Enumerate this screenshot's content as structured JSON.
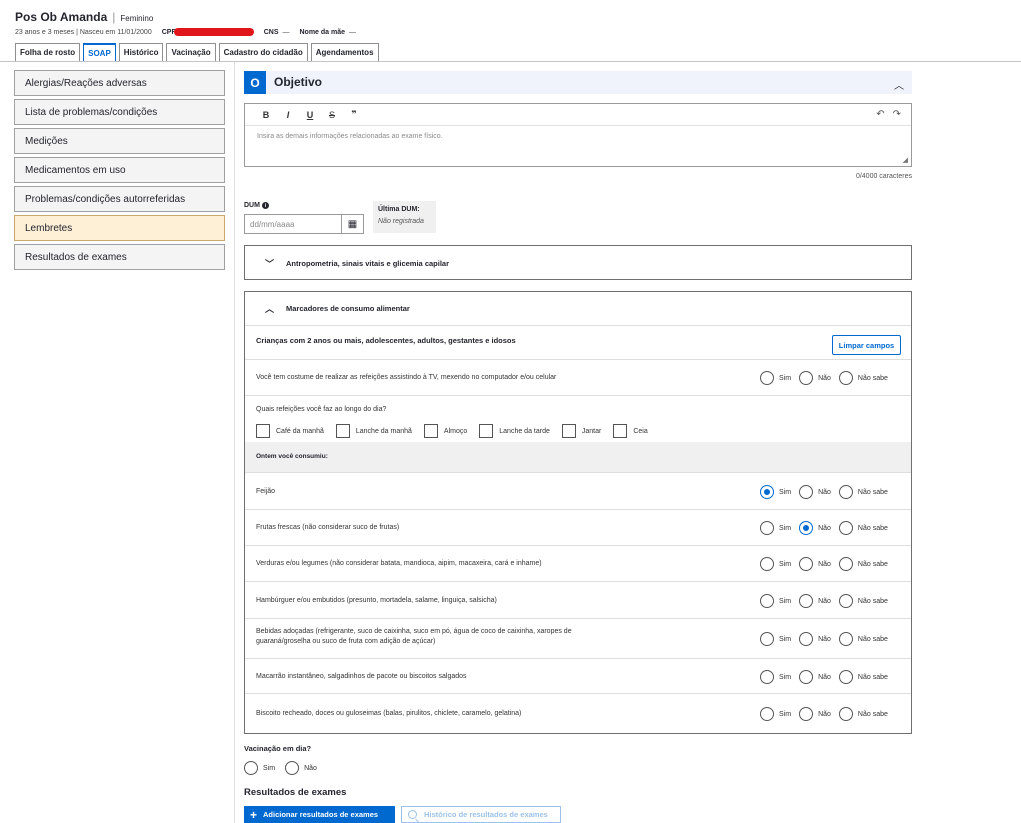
{
  "patient": {
    "name": "Pos Ob Amanda",
    "gender": "Feminino",
    "age_birth": "23 anos e 3 meses | Nasceu em 11/01/2000",
    "cpf_label": "CPF",
    "cns_label": "CNS",
    "cns_value": "—",
    "mother_label": "Nome da mãe",
    "mother_value": "—"
  },
  "tabs": [
    "Folha de rosto",
    "SOAP",
    "Histórico",
    "Vacinação",
    "Cadastro do cidadão",
    "Agendamentos"
  ],
  "active_tab": "SOAP",
  "sidebar": {
    "items": [
      "Alergias/Reações adversas",
      "Lista de problemas/condições",
      "Medições",
      "Medicamentos em uso",
      "Problemas/condições autorreferidas",
      "Lembretes",
      "Resultados de exames"
    ]
  },
  "objetivo": {
    "badge": "O",
    "title": "Objetivo",
    "toolbar": {
      "bold": "B",
      "italic": "I",
      "underline": "U",
      "strike": "S",
      "quote": "❞",
      "undo": "↶",
      "redo": "↷"
    },
    "placeholder": "Insira as demais informações relacionadas ao exame físico.",
    "char_count": "0/4000 caracteres"
  },
  "dum": {
    "label": "DUM",
    "placeholder": "dd/mm/aaaa",
    "ultima_label": "Última DUM:",
    "ultima_value": "Não registrada"
  },
  "antropometria": {
    "title": "Antropometria, sinais vitais e glicemia capilar"
  },
  "marcadores": {
    "title": "Marcadores de consumo alimentar",
    "section_title": "Crianças com 2 anos ou mais, adolescentes, adultos, gestantes e idosos",
    "limpar": "Limpar campos",
    "tv_question": "Você tem costume de realizar as refeições assistindo à TV, mexendo no computador e/ou celular",
    "meals_question": "Quais refeições você faz ao longo do dia?",
    "meals": [
      "Café da manhã",
      "Lanche da manhã",
      "Almoço",
      "Lanche da tarde",
      "Jantar",
      "Ceia"
    ],
    "ontem": "Ontem você consumiu:",
    "options": {
      "sim": "Sim",
      "nao": "Não",
      "nao_sabe": "Não sabe"
    },
    "foods": [
      {
        "q": "Feijão",
        "selected": "sim"
      },
      {
        "q": "Frutas frescas (não considerar suco de frutas)",
        "selected": "nao"
      },
      {
        "q": "Verduras e/ou legumes (não considerar batata, mandioca, aipim, macaxeira, cará e inhame)",
        "selected": ""
      },
      {
        "q": "Hambúrguer e/ou embutidos (presunto, mortadela, salame, linguiça, salsicha)",
        "selected": ""
      },
      {
        "q": "Bebidas adoçadas (refrigerante, suco de caixinha, suco em pó, água de coco de caixinha, xaropes de guaraná/groselha ou suco de fruta com adição de açúcar)",
        "selected": ""
      },
      {
        "q": "Macarrão instantâneo, salgadinhos de pacote ou biscoitos salgados",
        "selected": ""
      },
      {
        "q": "Biscoito recheado, doces ou guloseimas (balas, pirulitos, chiclete, caramelo, gelatina)",
        "selected": ""
      }
    ]
  },
  "vacinacao": {
    "label": "Vacinação em dia?",
    "sim": "Sim",
    "nao": "Não"
  },
  "resultados": {
    "title": "Resultados de exames",
    "add_button": "Adicionar resultados de exames",
    "hist_button": "Histórico de resultados de exames"
  },
  "colors": {
    "accent": "#0069d0",
    "highlight": "#fdf0d6",
    "redaction": "#e0161b"
  }
}
